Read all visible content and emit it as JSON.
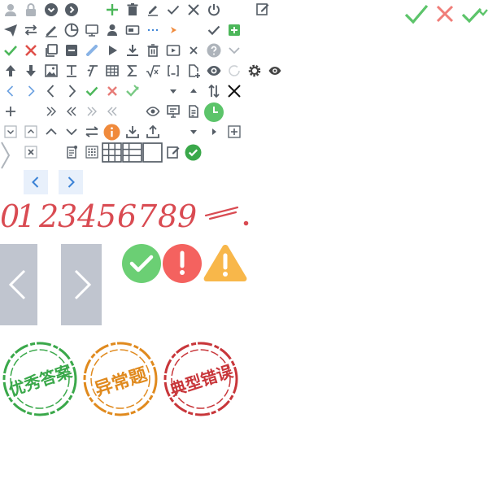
{
  "digits": [
    "0",
    "1",
    "2",
    "3",
    "4",
    "5",
    "6",
    "7",
    "8",
    "9"
  ],
  "stamps": [
    {
      "label": "优秀答案",
      "color": "#3aa84a"
    },
    {
      "label": "异常题",
      "color": "#e08a1e"
    },
    {
      "label": "典型错误",
      "color": "#c8363a"
    }
  ],
  "colors": {
    "icon_gray": "#555d66",
    "icon_light": "#aeb4bb",
    "icon_blue": "#3b82d6",
    "icon_green": "#4cb75a",
    "icon_red": "#e0504a",
    "digit_red": "#d94b52",
    "panel_gray": "#c0c5cf",
    "success_green": "#6bcf74",
    "error_red": "#f4625f",
    "warning_orange": "#f8b74a"
  }
}
